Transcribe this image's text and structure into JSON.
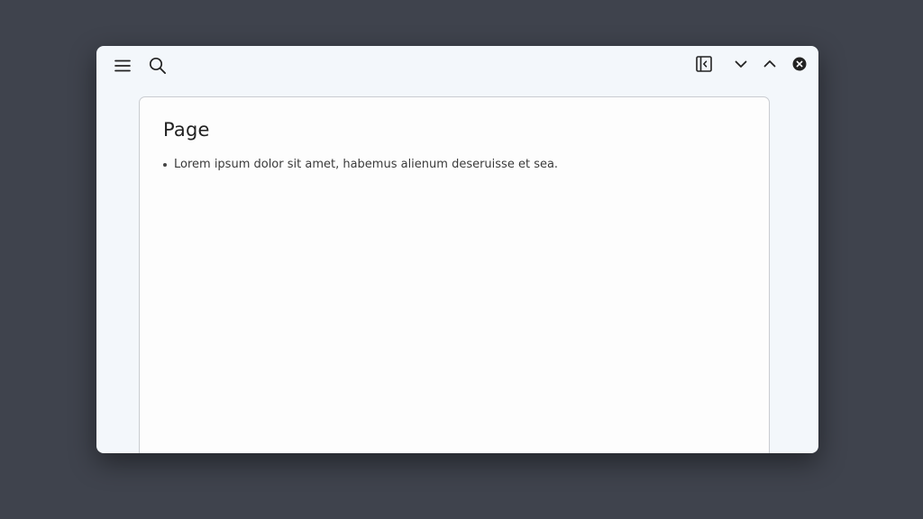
{
  "toolbar": {
    "left": [
      {
        "icon": "menu-icon"
      },
      {
        "icon": "search-icon"
      }
    ],
    "right": [
      {
        "icon": "sidebar-collapse-icon"
      },
      {
        "icon": "chevron-down-icon"
      },
      {
        "icon": "chevron-up-icon"
      },
      {
        "icon": "close-circle-icon"
      }
    ]
  },
  "page": {
    "title": "Page",
    "items": [
      "Lorem ipsum dolor sit amet, habemus alienum deseruisse et sea."
    ]
  },
  "colors": {
    "desktop": "#3f434d",
    "window": "#f3f7fb",
    "card": "#fdfdfd",
    "icon": "#222222"
  }
}
